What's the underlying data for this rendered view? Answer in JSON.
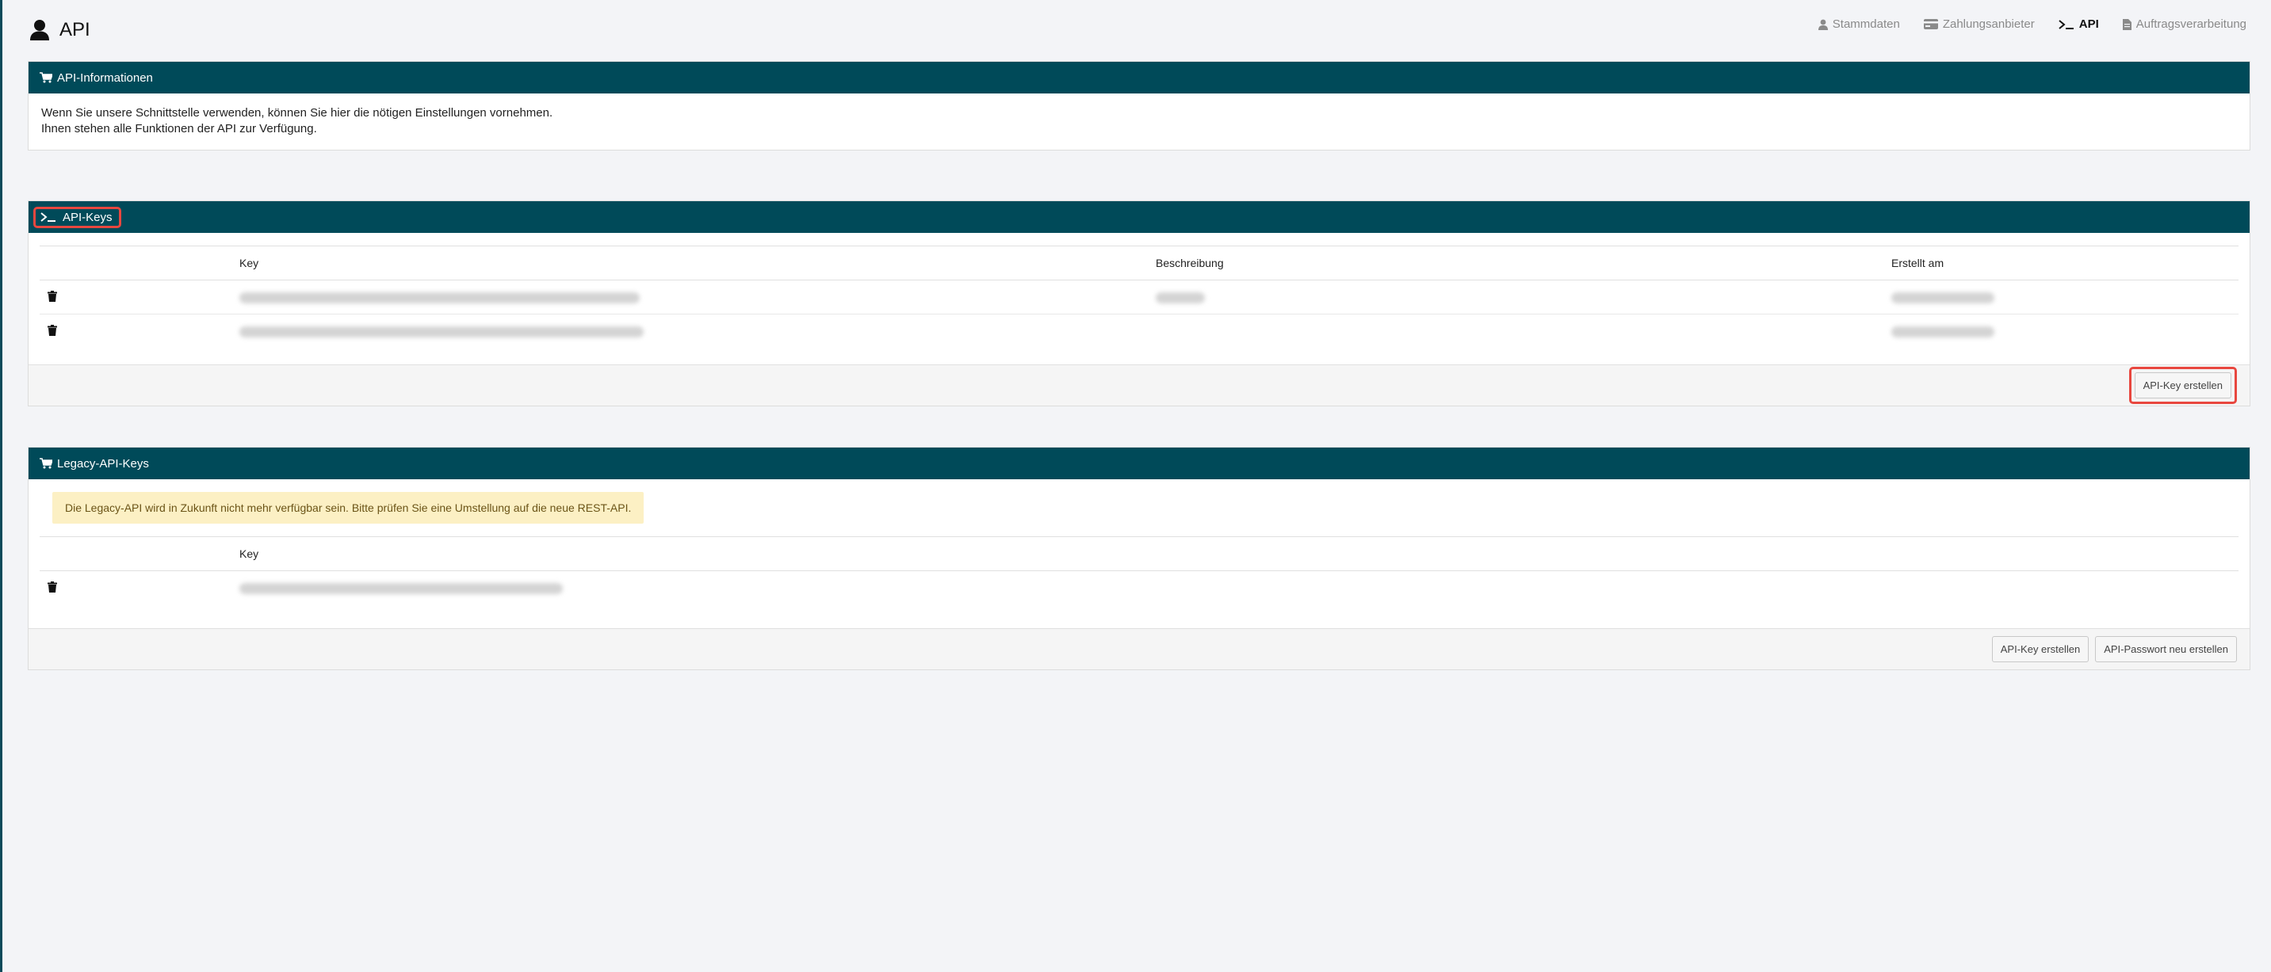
{
  "header": {
    "title": "API",
    "nav": [
      {
        "label": "Stammdaten",
        "icon": "user-icon",
        "active": false
      },
      {
        "label": "Zahlungsanbieter",
        "icon": "credit-card-icon",
        "active": false
      },
      {
        "label": "API",
        "icon": "terminal-icon",
        "active": true
      },
      {
        "label": "Auftragsverarbeitung",
        "icon": "file-icon",
        "active": false
      }
    ]
  },
  "info_panel": {
    "title": "API-Informationen",
    "line1": "Wenn Sie unsere Schnittstelle verwenden, können Sie hier die nötigen Einstellungen vornehmen.",
    "line2": "Ihnen stehen alle Funktionen der API zur Verfügung."
  },
  "keys_panel": {
    "title": "API-Keys",
    "columns": [
      "Key",
      "Beschreibung",
      "Erstellt am"
    ],
    "create_button": "API-Key erstellen"
  },
  "legacy_panel": {
    "title": "Legacy-API-Keys",
    "warning": "Die Legacy-API wird in Zukunft nicht mehr verfügbar sein. Bitte prüfen Sie eine Umstellung auf die neue REST-API.",
    "columns": [
      "Key"
    ],
    "create_button": "API-Key erstellen",
    "password_button": "API-Passwort neu erstellen"
  },
  "colors": {
    "panel_header": "#004a59",
    "highlight": "#e8473f",
    "warning_bg": "#fcf0c4",
    "background": "#f3f4f7"
  }
}
